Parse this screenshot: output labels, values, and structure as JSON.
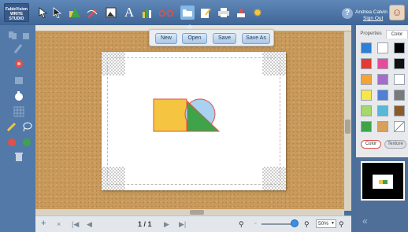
{
  "logo": {
    "text": "FableVision WRITE STUDIO"
  },
  "toolbar": {
    "icons": [
      "pointer-icon",
      "select-icon",
      "shapes-icon",
      "pencil-icon",
      "image-icon",
      "text-icon",
      "chart-icon",
      "glasses-icon",
      "folder-icon",
      "edit-page-icon",
      "print-icon",
      "stamp-icon",
      "settings-icon"
    ]
  },
  "file_menu": {
    "new_label": "New",
    "open_label": "Open",
    "save_label": "Save",
    "saveas_label": "Save As"
  },
  "user": {
    "help": "?",
    "name": "Andrea Calvin",
    "signout": "Sign Out"
  },
  "panel": {
    "tab_properties": "Properties",
    "tab_color": "Color",
    "color_button": "Color",
    "texture_button": "Texture",
    "swatches": [
      "#2e7fd6",
      "#ffffff",
      "#000000",
      "#e53935",
      "#e44d9e",
      "#111111",
      "#f4a335",
      "#a66ccc",
      "#ffffff",
      "#f7e64b",
      "#4f7fd6",
      "#7a7a7a",
      "#a6d86b",
      "#58b8d6",
      "#8b5a2b",
      "#3fa34a",
      "#d7a05c",
      "#ffffff"
    ]
  },
  "canvas_shapes": {
    "square_color": "#f5c542",
    "circle_color": "#a9d1f0",
    "triangle_color": "#3fa34a",
    "outline_color": "#e0514a"
  },
  "pager": {
    "current": "1 / 1"
  },
  "zoom": {
    "value": "50%"
  }
}
